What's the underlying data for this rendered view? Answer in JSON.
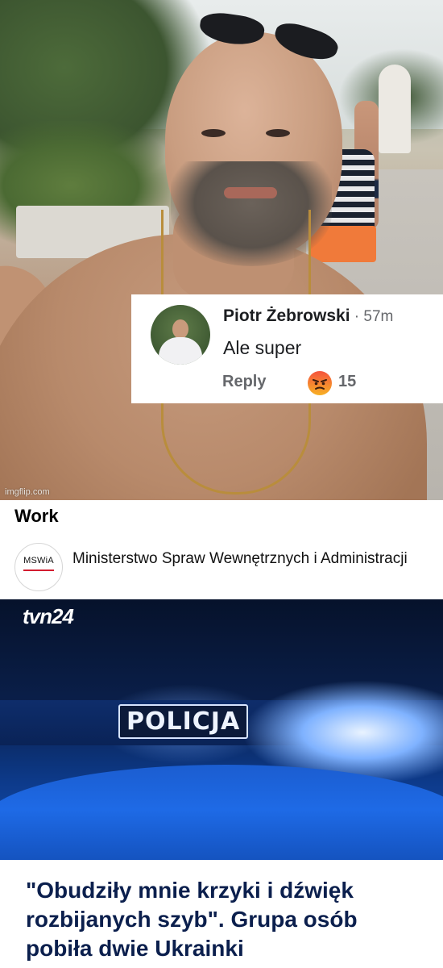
{
  "meme": {
    "watermark": "imgflip.com",
    "comment": {
      "author": "Piotr Żebrowski",
      "time": " · 57m",
      "text": "Ale super",
      "reply_label": "Reply",
      "reaction_icon": "angry-emoji",
      "reaction_count": "15"
    }
  },
  "post": {
    "label": "Work",
    "source": {
      "logo_text": "MSWiA",
      "name": "Ministerstwo Spraw Wewnętrznych i Administracji"
    },
    "image": {
      "brand": "tvn24",
      "sign": "POLICJA"
    },
    "headline": "\"Obudziły mnie krzyki i dźwięk rozbijanych szyb\". Grupa osób pobiła dwie Ukrainki"
  },
  "colors": {
    "headline": "#0b1f4d",
    "ministry_red": "#d31c2f",
    "police_blue": "#1552b8"
  }
}
